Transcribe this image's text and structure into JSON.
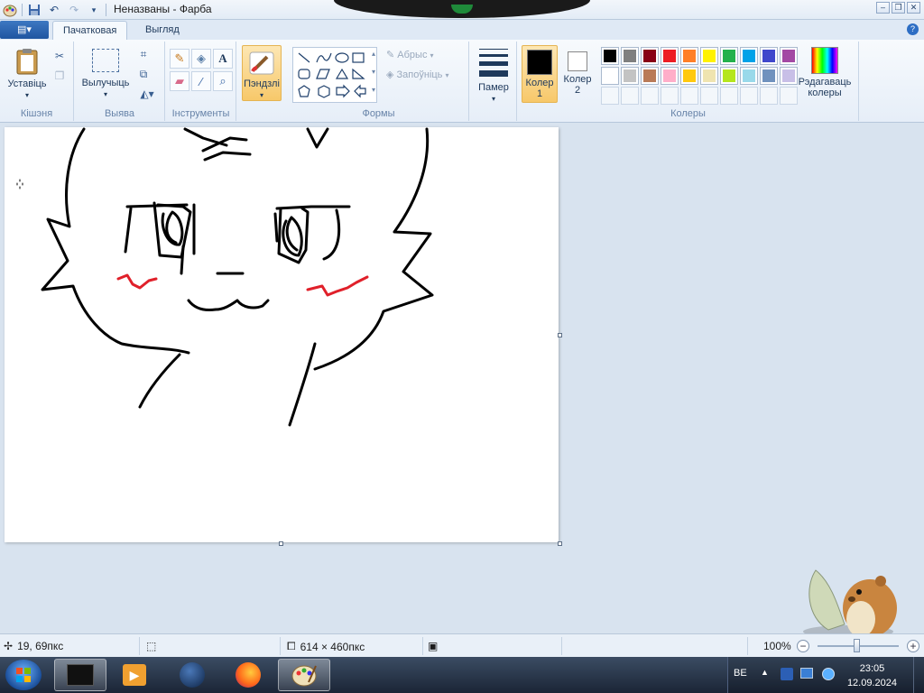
{
  "window": {
    "title": "Неназваны - Фарба"
  },
  "tabs": {
    "file_icon": "▤▾",
    "home": "Пачатковая",
    "view": "Выгляд",
    "help": "?"
  },
  "ribbon": {
    "clipboard": {
      "paste": "Уставіць",
      "label": "Кішэня"
    },
    "image": {
      "select": "Вылучыць",
      "label": "Выява"
    },
    "tools": {
      "label": "Інструменты"
    },
    "brushes": {
      "label": "Пэндзлі"
    },
    "shapes": {
      "outline": "Абрыс",
      "fill": "Запоўніць",
      "label": "Формы"
    },
    "size": {
      "label": "Памер"
    },
    "colors": {
      "color1": "Колер 1",
      "color2": "Колер 2",
      "edit": "Рэдагаваць колеры",
      "label": "Колеры",
      "palette_row1": [
        "#000000",
        "#7f7f7f",
        "#880015",
        "#ed1c24",
        "#ff7f27",
        "#fff200",
        "#22b14c",
        "#00a2e8",
        "#3f48cc",
        "#a349a4"
      ],
      "palette_row2": [
        "#ffffff",
        "#c3c3c3",
        "#b97a57",
        "#ffaec9",
        "#ffc90e",
        "#efe4b0",
        "#b5e61d",
        "#99d9ea",
        "#7092be",
        "#c8bfe7"
      ]
    }
  },
  "status": {
    "cursor": "19, 69пкс",
    "size": "614 × 460пкс",
    "zoom": "100%",
    "zoom_level": 1.0
  },
  "taskbar": {
    "lang": "BE",
    "time": "23:05",
    "date": "12.09.2024"
  }
}
